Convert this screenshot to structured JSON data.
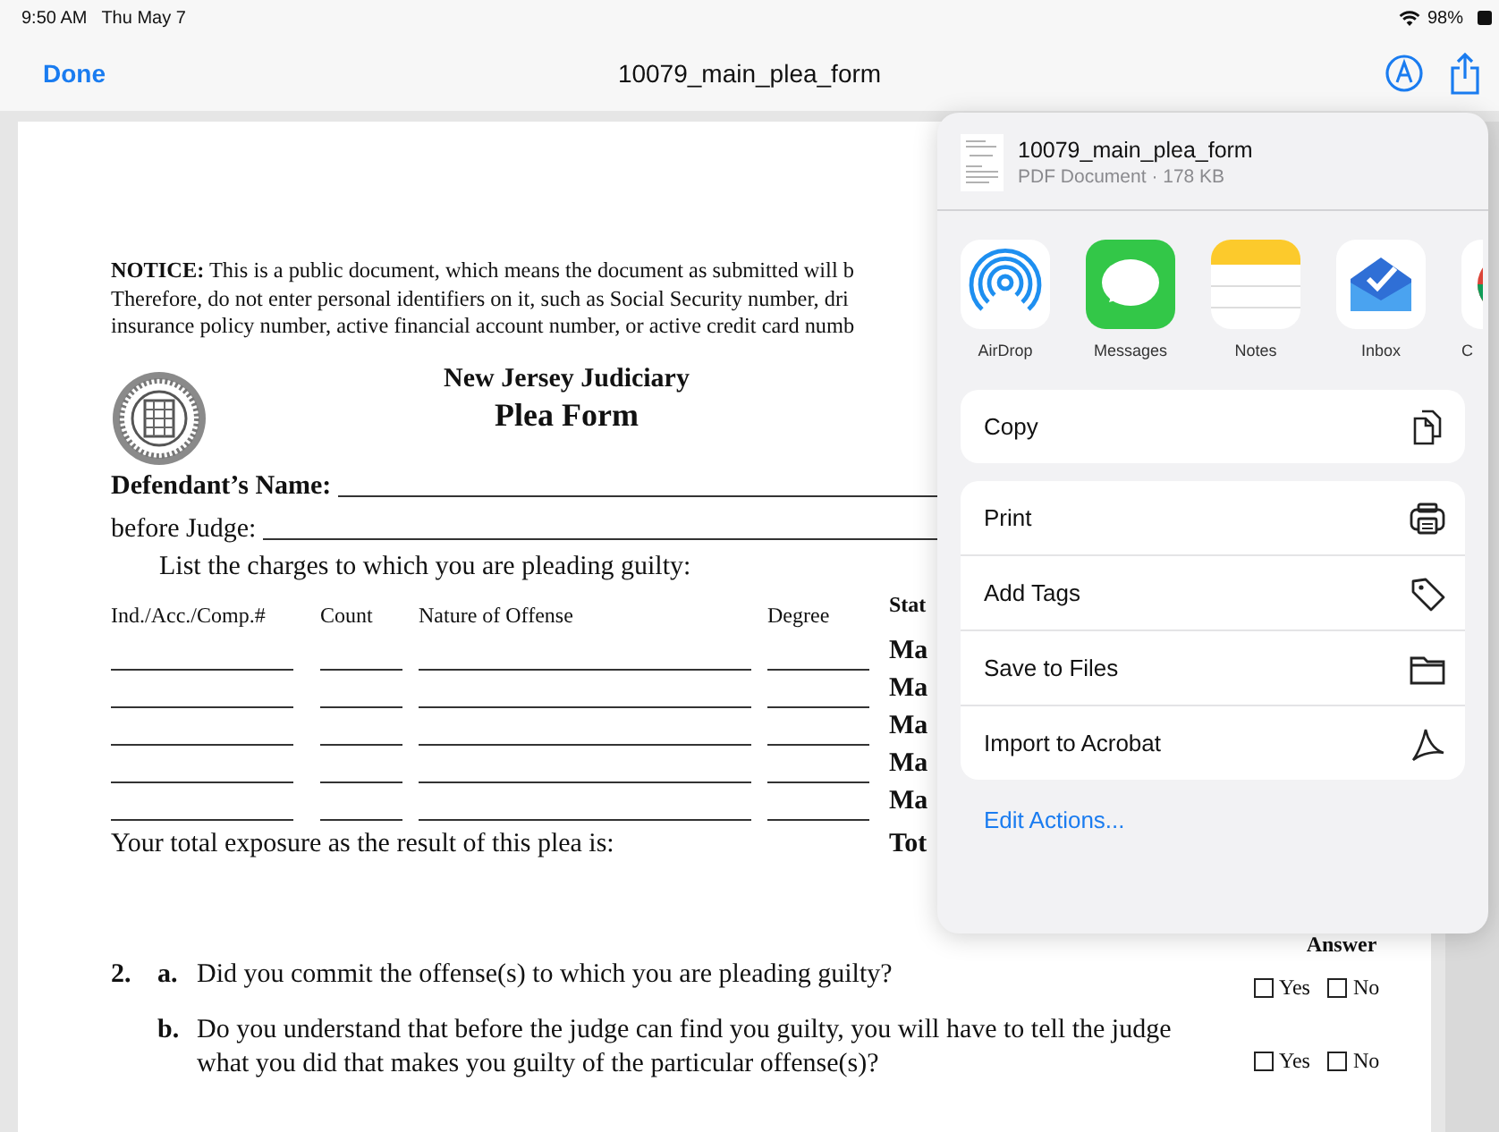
{
  "status_bar": {
    "time": "9:50 AM",
    "date": "Thu May 7",
    "battery": "98%"
  },
  "nav": {
    "done": "Done",
    "title": "10079_main_plea_form"
  },
  "document": {
    "notice_lines": [
      "**NOTICE:** This is a public document, which means the document as submitted will b",
      "Therefore, do not enter personal identifiers on it, such as Social Security number, dri",
      "insurance policy number, active financial account number, or active credit card numb"
    ],
    "court": "New Jersey Judiciary",
    "form_title": "Plea Form",
    "name_label": "Defendant’s Name:",
    "judge_label": "before Judge:",
    "charges_prompt": "List the charges to which you are pleading guilty:",
    "statute_header": "Stat",
    "columns": [
      "Ind./Acc./Comp.#",
      "Count",
      "Nature of Offense",
      "Degree"
    ],
    "charge_rows": [
      {
        "statute": "Ma"
      },
      {
        "statute": "Ma"
      },
      {
        "statute": "Ma"
      },
      {
        "statute": "Ma"
      },
      {
        "statute": "Ma"
      }
    ],
    "total_label": "Your total exposure as the result of this plea is:",
    "total_statute": "Tot",
    "answer_header": "Answer",
    "questions": [
      {
        "number": "2.",
        "letter": "a.",
        "text": "Did you commit the offense(s) to which you are pleading guilty?",
        "options": [
          {
            "label": "Yes",
            "checked": false
          },
          {
            "label": "No",
            "checked": false
          }
        ]
      },
      {
        "letter": "b.",
        "text": "Do you understand that before the judge can find you guilty, you will have to tell the judge what you did that makes you guilty of the particular offense(s)?",
        "options": [
          {
            "label": "Yes",
            "checked": false
          },
          {
            "label": "No",
            "checked": false
          }
        ]
      }
    ]
  },
  "share_sheet": {
    "title": "10079_main_plea_form",
    "subtitle": "PDF Document · 178 KB",
    "apps": [
      {
        "kind": "airdrop",
        "label": "AirDrop"
      },
      {
        "kind": "messages",
        "label": "Messages"
      },
      {
        "kind": "notes",
        "label": "Notes"
      },
      {
        "kind": "inbox",
        "label": "Inbox"
      },
      {
        "kind": "chrome",
        "label": "C"
      }
    ],
    "action_groups": [
      [
        {
          "kind": "copy",
          "label": "Copy"
        }
      ],
      [
        {
          "kind": "print",
          "label": "Print"
        },
        {
          "kind": "tag",
          "label": "Add Tags"
        },
        {
          "kind": "folder",
          "label": "Save to Files"
        },
        {
          "kind": "acrobat",
          "label": "Import to Acrobat"
        }
      ]
    ],
    "edit_link": "Edit Actions..."
  }
}
